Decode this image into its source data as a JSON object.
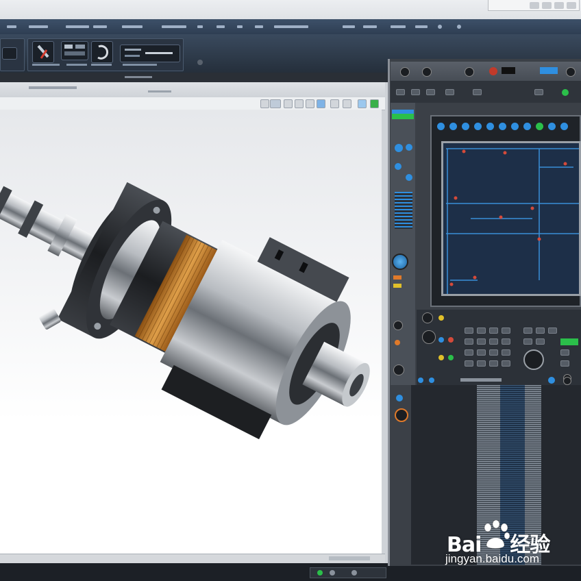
{
  "watermark": {
    "brand_left": "Bai",
    "brand_right": "经验",
    "url": "jingyan.baidu.com"
  },
  "colors": {
    "chrome_dark": "#2e3e53",
    "viewport_bg": "#ffffff",
    "screen_bg": "#1d2f48",
    "screen_lines": "#3a8fd8",
    "copper_coil": "#c8842a",
    "accent_blue": "#2f8fe0",
    "accent_orange": "#e07a2a",
    "accent_green": "#2bbf4a"
  },
  "icons": {
    "menu": "menu-label-icon",
    "spindle": "spindle-model",
    "watermark": "baidu-paw-icon"
  }
}
